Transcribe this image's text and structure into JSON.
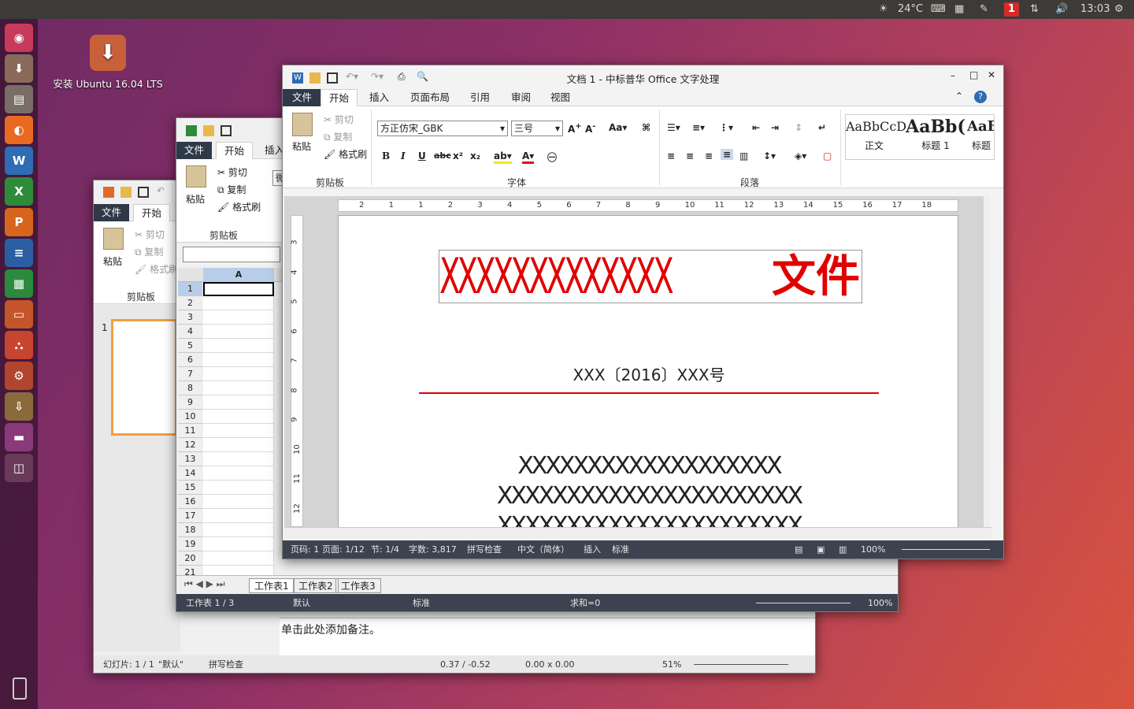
{
  "panel": {
    "weather": "24°C",
    "badge": "1",
    "time": "13:03"
  },
  "desktop": {
    "icon_label": "安装 Ubuntu 16.04 LTS"
  },
  "launcher": [
    {
      "name": "ubuntu-dash-icon",
      "glyph": "◉",
      "color": "#c73a5c"
    },
    {
      "name": "installer-icon",
      "glyph": "⬇",
      "color": "#8a6a5a"
    },
    {
      "name": "files-icon",
      "glyph": "▤",
      "color": "#7a6d66"
    },
    {
      "name": "firefox-icon",
      "glyph": "◐",
      "color": "#e86a21"
    },
    {
      "name": "writer-icon",
      "glyph": "W",
      "color": "#2f6cb3"
    },
    {
      "name": "spreadsheet-icon",
      "glyph": "X",
      "color": "#2e8b3a"
    },
    {
      "name": "presentation-icon",
      "glyph": "P",
      "color": "#d8651f"
    },
    {
      "name": "libreoffice-writer-icon",
      "glyph": "≡",
      "color": "#2b5ea3"
    },
    {
      "name": "libreoffice-calc-icon",
      "glyph": "▦",
      "color": "#2c8a3f"
    },
    {
      "name": "libreoffice-impress-icon",
      "glyph": "▭",
      "color": "#c4552a"
    },
    {
      "name": "software-center-icon",
      "glyph": "⛬",
      "color": "#c7452e"
    },
    {
      "name": "settings-icon",
      "glyph": "⚙",
      "color": "#b2452d"
    },
    {
      "name": "updater-icon",
      "glyph": "⇩",
      "color": "#8a6a3a"
    },
    {
      "name": "screen-icon",
      "glyph": "▬",
      "color": "#8a3a78"
    },
    {
      "name": "workspace-icon",
      "glyph": "◫",
      "color": "#6a3a5a"
    }
  ],
  "impress": {
    "tabs": {
      "file": "文件",
      "home": "开始"
    },
    "clipboard": {
      "paste": "粘贴",
      "cut": "剪切",
      "copy": "复制",
      "format": "格式刷",
      "group": "剪贴板"
    },
    "slide_number": "1",
    "notes": "单击此处添加备注。",
    "status": {
      "slide": "幻灯片: 1 / 1",
      "layout": "\"默认\"",
      "spell": "拼写检查",
      "pos": "0.37 / -0.52",
      "size": "0.00 x 0.00",
      "zoom": "51%"
    }
  },
  "calc": {
    "tabs": {
      "file": "文件",
      "home": "开始",
      "insert": "插入"
    },
    "clipboard": {
      "paste": "粘贴",
      "cut": "剪切",
      "copy": "复制",
      "format": "格式刷",
      "group": "剪贴板"
    },
    "font_stub": "微",
    "col_header": "A",
    "rows": [
      "1",
      "2",
      "3",
      "4",
      "5",
      "6",
      "7",
      "8",
      "9",
      "10",
      "11",
      "12",
      "13",
      "14",
      "15",
      "16",
      "17",
      "18",
      "19",
      "20",
      "21"
    ],
    "sheets": [
      "工作表1",
      "工作表2",
      "工作表3"
    ],
    "status": {
      "sheet": "工作表 1 / 3",
      "style": "默认",
      "mode": "标准",
      "sum": "求和=0",
      "zoom": "100%"
    }
  },
  "writer": {
    "title": "文档 1 - 中标普华 Office 文字处理",
    "tabs": {
      "file": "文件",
      "home": "开始",
      "insert": "插入",
      "layout": "页面布局",
      "ref": "引用",
      "review": "审阅",
      "view": "视图"
    },
    "clipboard": {
      "paste": "粘贴",
      "cut": "剪切",
      "copy": "复制",
      "format": "格式刷",
      "group": "剪贴板"
    },
    "font": {
      "name": "方正仿宋_GBK",
      "size": "三号",
      "group": "字体"
    },
    "paragraph_group": "段落",
    "styles": [
      {
        "sample": "AaBbCcD",
        "label": "正文"
      },
      {
        "sample": "AaBb(",
        "label": "标题 1"
      },
      {
        "sample": "AaB",
        "label": "标题"
      }
    ],
    "ruler_h": [
      "2",
      "1",
      "1",
      "2",
      "3",
      "4",
      "5",
      "6",
      "7",
      "8",
      "9",
      "10",
      "11",
      "12",
      "13",
      "14",
      "15",
      "16",
      "17",
      "18"
    ],
    "ruler_v": [
      "3",
      "4",
      "5",
      "6",
      "7",
      "8",
      "9",
      "10",
      "11",
      "12"
    ],
    "doc": {
      "header_x": "XXXXXXXXXXXXX",
      "header_word": "文件",
      "docno_x1": "XXX",
      "docno_year": "〔2016〕",
      "docno_x2": "XXX",
      "docno_suffix": "号",
      "line1": "XXXXXXXXXXXXXXXXXXX",
      "line2": "XXXXXXXXXXXXXXXXXXXXXX",
      "line3": "XXXXXXXXXXXXXXXXXXXXXX"
    },
    "status": {
      "page": "页码: 1",
      "pages": "页面: 1/12",
      "section": "节: 1/4",
      "words": "字数: 3,817",
      "spell": "拼写检查",
      "lang": "中文（简体）",
      "insert": "插入",
      "mode": "标准",
      "zoom": "100%"
    }
  }
}
